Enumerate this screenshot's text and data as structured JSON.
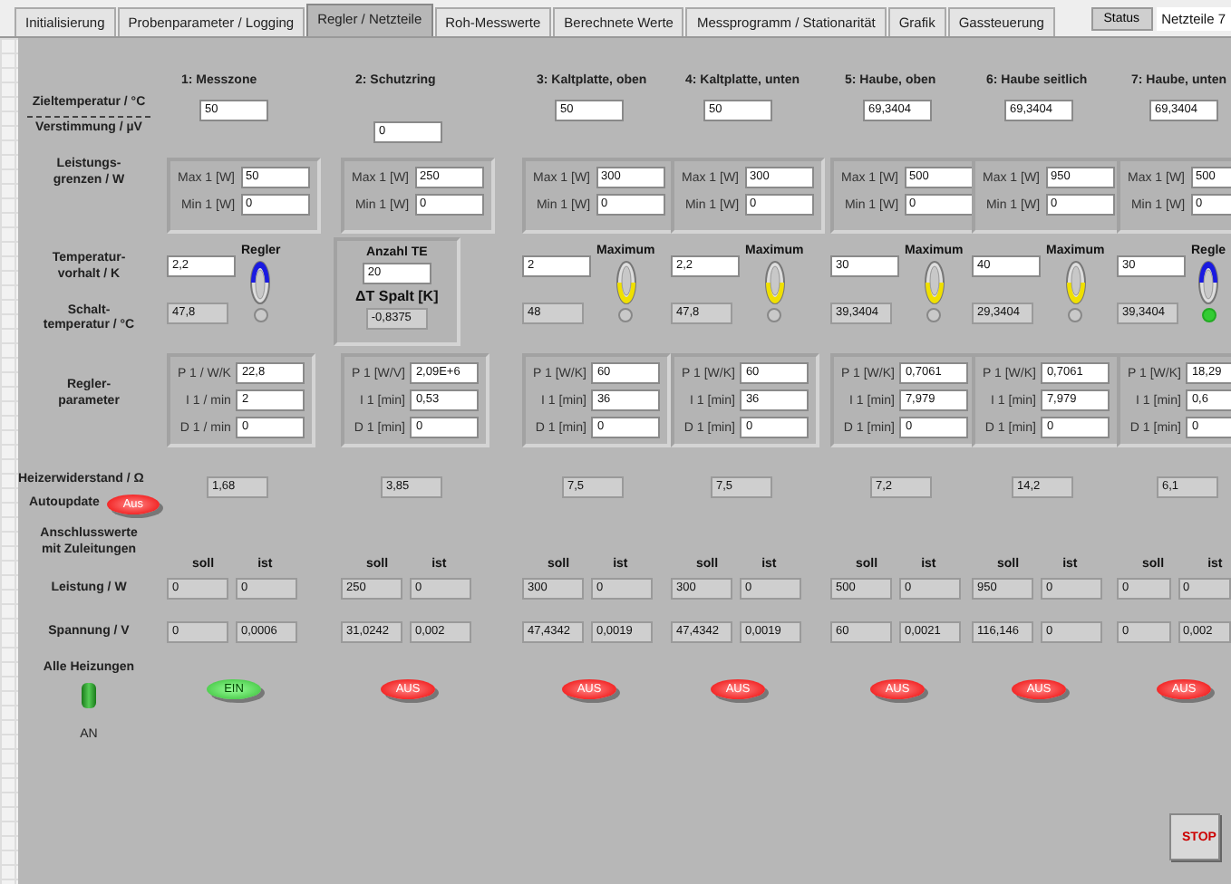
{
  "tabs": [
    {
      "label": "Initialisierung",
      "selected": false
    },
    {
      "label": "Probenparameter / Logging",
      "selected": false
    },
    {
      "label": "Regler / Netzteile",
      "selected": true
    },
    {
      "label": "Roh-Messwerte",
      "selected": false
    },
    {
      "label": "Berechnete Werte",
      "selected": false
    },
    {
      "label": "Messprogramm / Stationarität",
      "selected": false
    },
    {
      "label": "Grafik",
      "selected": false
    },
    {
      "label": "Gassteuerung",
      "selected": false
    }
  ],
  "status_button": "Status",
  "status_field": "Netzteile 7",
  "labels": {
    "ziel": "Zieltemperatur / °C",
    "verstimmung": "Verstimmung / µV",
    "leistungsgrenzen": [
      "Leistungs-",
      "grenzen / W"
    ],
    "vorhalt": [
      "Temperatur-",
      "vorhalt / K"
    ],
    "schalt": [
      "Schalt-",
      "temperatur / °C"
    ],
    "regler": [
      "Regler-",
      "parameter"
    ],
    "widerstand": "Heizerwiderstand / Ω",
    "autoupdate": "Autoupdate",
    "anschluss": [
      "Anschlusswerte",
      "mit Zuleitungen"
    ],
    "leistung": "Leistung / W",
    "spannung": "Spannung / V",
    "alle": "Alle Heizungen",
    "alle_state": "AN"
  },
  "autoupdate_button": {
    "label": "Aus",
    "on": false
  },
  "alle_switch": {
    "on": true
  },
  "columns": [
    {
      "title": "1: Messzone",
      "target": {
        "kind": "ziel",
        "value": "50"
      },
      "power": [
        {
          "label": "Max 1 [W]",
          "value": "50"
        },
        {
          "label": "Min 1 [W]",
          "value": "0"
        }
      ],
      "kind": "regler",
      "vorhalt": "2,2",
      "switch": {
        "label": "Regler",
        "up": true,
        "lit": false
      },
      "schalt": "47,8",
      "params": [
        {
          "label": "P 1 / W/K",
          "value": "22,8"
        },
        {
          "label": "I 1 / min",
          "value": "2"
        },
        {
          "label": "D 1 / min",
          "value": "0"
        }
      ],
      "widerstand": "1,68",
      "soll_label": "soll",
      "ist_label": "ist",
      "leistung": {
        "soll": "0",
        "ist": "0"
      },
      "spannung": {
        "soll": "0",
        "ist": "0,0006"
      },
      "heater": {
        "label": "EIN",
        "on": true
      }
    },
    {
      "title": "2: Schutzring",
      "target": {
        "kind": "verstimmung",
        "value": "0"
      },
      "power": [
        {
          "label": "Max 1 [W]",
          "value": "250"
        },
        {
          "label": "Min 1 [W]",
          "value": "0"
        }
      ],
      "kind": "te",
      "te_label": "Anzahl TE",
      "te": "20",
      "spalt_label": "ΔT Spalt [K]",
      "spalt": "-0,8375",
      "params": [
        {
          "label": "P 1 [W/V]",
          "value": "2,09E+6"
        },
        {
          "label": "I 1 [min]",
          "value": "0,53"
        },
        {
          "label": "D 1 [min]",
          "value": "0"
        }
      ],
      "widerstand": "3,85",
      "soll_label": "soll",
      "ist_label": "ist",
      "leistung": {
        "soll": "250",
        "ist": "0"
      },
      "spannung": {
        "soll": "31,0242",
        "ist": "0,002"
      },
      "heater": {
        "label": "AUS",
        "on": false
      }
    },
    {
      "title": "3: Kaltplatte, oben",
      "target": {
        "kind": "ziel",
        "value": "50"
      },
      "power": [
        {
          "label": "Max 1 [W]",
          "value": "300"
        },
        {
          "label": "Min 1 [W]",
          "value": "0"
        }
      ],
      "kind": "regler",
      "vorhalt": "2",
      "switch": {
        "label": "Maximum",
        "up": false,
        "lit": false
      },
      "schalt": "48",
      "params": [
        {
          "label": "P 1 [W/K]",
          "value": "60"
        },
        {
          "label": "I 1 [min]",
          "value": "36"
        },
        {
          "label": "D 1 [min]",
          "value": "0"
        }
      ],
      "widerstand": "7,5",
      "soll_label": "soll",
      "ist_label": "ist",
      "leistung": {
        "soll": "300",
        "ist": "0"
      },
      "spannung": {
        "soll": "47,4342",
        "ist": "0,0019"
      },
      "heater": {
        "label": "AUS",
        "on": false
      }
    },
    {
      "title": "4: Kaltplatte, unten",
      "target": {
        "kind": "ziel",
        "value": "50"
      },
      "power": [
        {
          "label": "Max 1 [W]",
          "value": "300"
        },
        {
          "label": "Min 1 [W]",
          "value": "0"
        }
      ],
      "kind": "regler",
      "vorhalt": "2,2",
      "switch": {
        "label": "Maximum",
        "up": false,
        "lit": false
      },
      "schalt": "47,8",
      "params": [
        {
          "label": "P 1 [W/K]",
          "value": "60"
        },
        {
          "label": "I 1 [min]",
          "value": "36"
        },
        {
          "label": "D 1 [min]",
          "value": "0"
        }
      ],
      "widerstand": "7,5",
      "soll_label": "soll",
      "ist_label": "ist",
      "leistung": {
        "soll": "300",
        "ist": "0"
      },
      "spannung": {
        "soll": "47,4342",
        "ist": "0,0019"
      },
      "heater": {
        "label": "AUS",
        "on": false
      }
    },
    {
      "title": "5: Haube, oben",
      "target": {
        "kind": "ziel",
        "value": "69,3404"
      },
      "power": [
        {
          "label": "Max 1 [W]",
          "value": "500"
        },
        {
          "label": "Min 1 [W]",
          "value": "0"
        }
      ],
      "kind": "regler",
      "vorhalt": "30",
      "switch": {
        "label": "Maximum",
        "up": false,
        "lit": false
      },
      "schalt": "39,3404",
      "params": [
        {
          "label": "P 1 [W/K]",
          "value": "0,7061"
        },
        {
          "label": "I 1 [min]",
          "value": "7,979"
        },
        {
          "label": "D 1 [min]",
          "value": "0"
        }
      ],
      "widerstand": "7,2",
      "soll_label": "soll",
      "ist_label": "ist",
      "leistung": {
        "soll": "500",
        "ist": "0"
      },
      "spannung": {
        "soll": "60",
        "ist": "0,0021"
      },
      "heater": {
        "label": "AUS",
        "on": false
      }
    },
    {
      "title": "6: Haube seitlich",
      "target": {
        "kind": "ziel",
        "value": "69,3404"
      },
      "power": [
        {
          "label": "Max 1 [W]",
          "value": "950"
        },
        {
          "label": "Min 1 [W]",
          "value": "0"
        }
      ],
      "kind": "regler",
      "vorhalt": "40",
      "switch": {
        "label": "Maximum",
        "up": false,
        "lit": false
      },
      "schalt": "29,3404",
      "params": [
        {
          "label": "P 1 [W/K]",
          "value": "0,7061"
        },
        {
          "label": "I 1 [min]",
          "value": "7,979"
        },
        {
          "label": "D 1 [min]",
          "value": "0"
        }
      ],
      "widerstand": "14,2",
      "soll_label": "soll",
      "ist_label": "ist",
      "leistung": {
        "soll": "950",
        "ist": "0"
      },
      "spannung": {
        "soll": "116,146",
        "ist": "0"
      },
      "heater": {
        "label": "AUS",
        "on": false
      }
    },
    {
      "title": "7: Haube, unten",
      "target": {
        "kind": "ziel",
        "value": "69,3404"
      },
      "power": [
        {
          "label": "Max 1 [W]",
          "value": "500"
        },
        {
          "label": "Min 1 [W]",
          "value": "0"
        }
      ],
      "kind": "regler",
      "vorhalt": "30",
      "switch": {
        "label": "Regle",
        "up": true,
        "lit": true
      },
      "schalt": "39,3404",
      "params": [
        {
          "label": "P 1 [W/K]",
          "value": "18,29"
        },
        {
          "label": "I 1 [min]",
          "value": "0,6"
        },
        {
          "label": "D 1 [min]",
          "value": "0"
        }
      ],
      "widerstand": "6,1",
      "soll_label": "soll",
      "ist_label": "ist",
      "leistung": {
        "soll": "0",
        "ist": "0"
      },
      "spannung": {
        "soll": "0",
        "ist": "0,002"
      },
      "heater": {
        "label": "AUS",
        "on": false
      }
    }
  ],
  "stop_button": "STOP"
}
